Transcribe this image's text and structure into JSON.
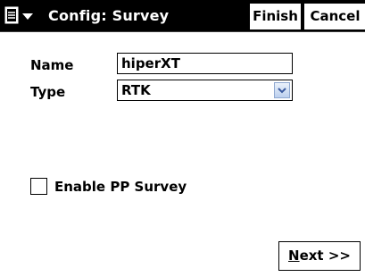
{
  "titlebar": {
    "menu_icon": "document-menu-icon",
    "title": "Config: Survey",
    "finish_label": "Finish",
    "cancel_label": "Cancel"
  },
  "form": {
    "name_label": "Name",
    "name_value": "hiperXT",
    "type_label": "Type",
    "type_value": "RTK",
    "pp_checkbox_label": "Enable PP Survey",
    "pp_checked": false
  },
  "footer": {
    "next_label": "Next >>"
  },
  "colors": {
    "titlebar_bg": "#000000",
    "dropdown_arrow": "#3a5aa0"
  }
}
